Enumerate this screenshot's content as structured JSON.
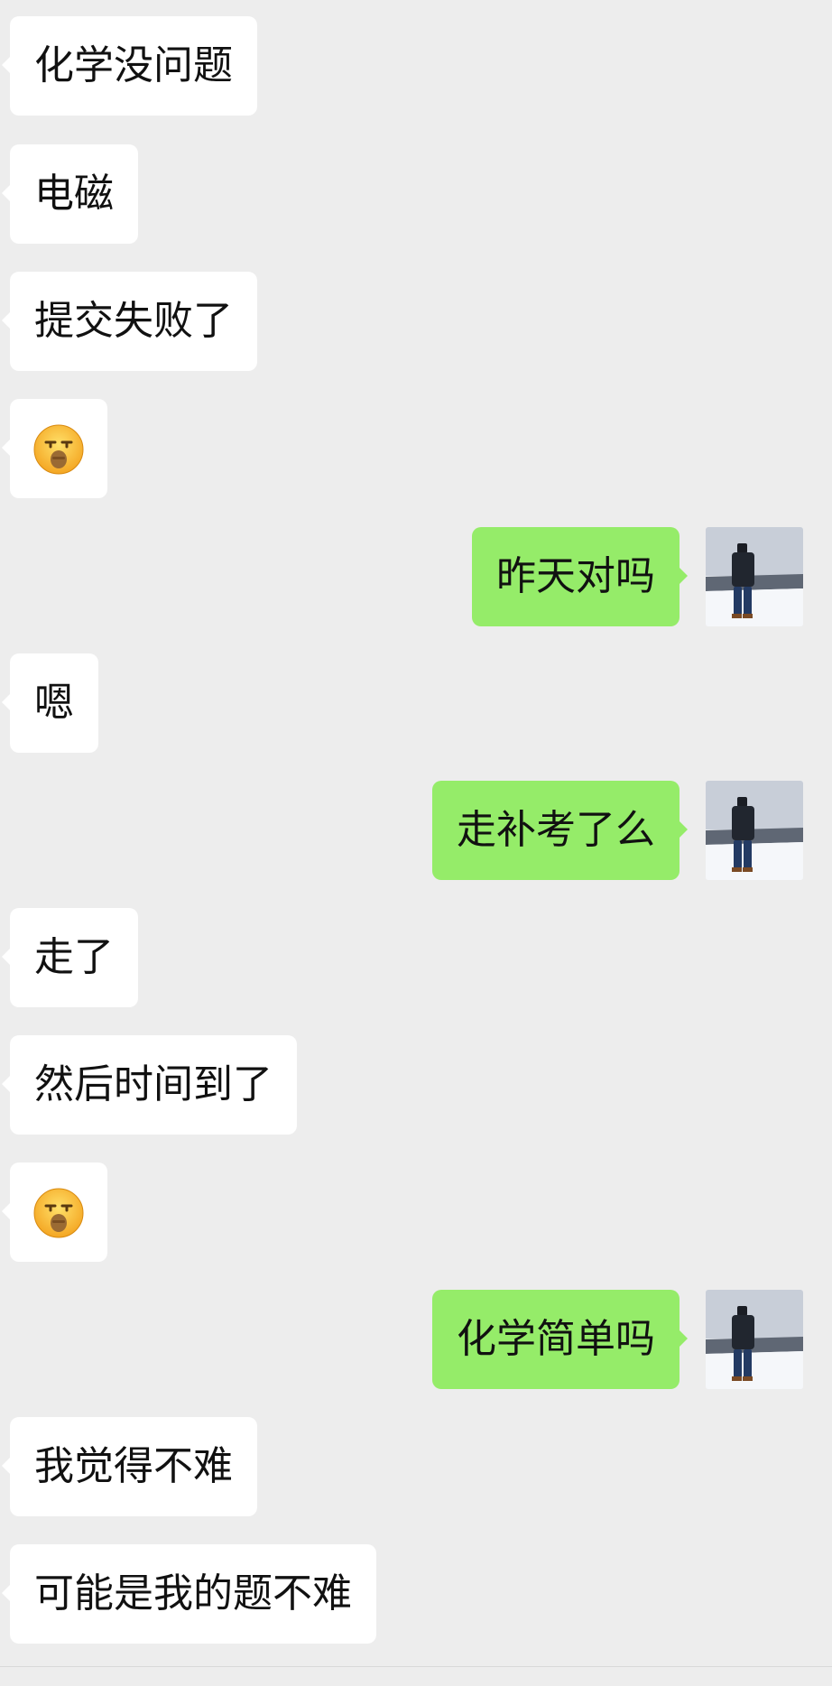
{
  "messages": [
    {
      "side": "left",
      "type": "text",
      "text": "化学没问题"
    },
    {
      "side": "left",
      "type": "text",
      "text": "电磁"
    },
    {
      "side": "left",
      "type": "text",
      "text": "提交失败了"
    },
    {
      "side": "left",
      "type": "emoji",
      "emoji_name": "sleepy-face-icon"
    },
    {
      "side": "right",
      "type": "text",
      "text": "昨天对吗"
    },
    {
      "side": "left",
      "type": "text",
      "text": "嗯"
    },
    {
      "side": "right",
      "type": "text",
      "text": "走补考了么"
    },
    {
      "side": "left",
      "type": "text",
      "text": "走了"
    },
    {
      "side": "left",
      "type": "text",
      "text": "然后时间到了"
    },
    {
      "side": "left",
      "type": "emoji",
      "emoji_name": "sleepy-face-icon"
    },
    {
      "side": "right",
      "type": "text",
      "text": "化学简单吗"
    },
    {
      "side": "left",
      "type": "text",
      "text": "我觉得不难"
    },
    {
      "side": "left",
      "type": "text",
      "text": "可能是我的题不难"
    }
  ],
  "colors": {
    "background": "#ededed",
    "incoming_bubble": "#ffffff",
    "outgoing_bubble": "#95ec69",
    "text": "#111111"
  }
}
